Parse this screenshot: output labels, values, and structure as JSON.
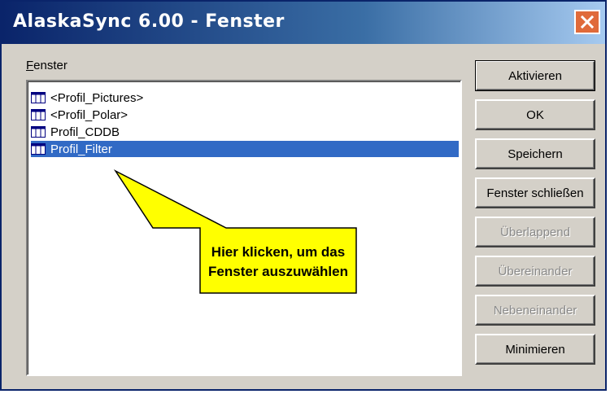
{
  "window": {
    "title": "AlaskaSync 6.00 - Fenster",
    "close_icon": "close-icon"
  },
  "list": {
    "label": "Fenster",
    "items": [
      {
        "label": "<Profil_Pictures>",
        "icon": "grid-window-icon",
        "selected": false
      },
      {
        "label": "<Profil_Polar>",
        "icon": "grid-window-icon",
        "selected": false
      },
      {
        "label": "Profil_CDDB",
        "icon": "grid-window-icon",
        "selected": false
      },
      {
        "label": "Profil_Filter",
        "icon": "grid-window-icon",
        "selected": true
      }
    ]
  },
  "buttons": {
    "activate": "Aktivieren",
    "ok": "OK",
    "save": "Speichern",
    "close_window": "Fenster schließen",
    "cascade": "Überlappend",
    "tile_horizontal": "Übereinander",
    "tile_vertical": "Nebeneinander",
    "minimize": "Minimieren"
  },
  "callout": {
    "line1": "Hier klicken, um das",
    "line2": "Fenster auszuwählen"
  },
  "colors": {
    "titlebar_start": "#0a246a",
    "titlebar_end": "#a6caf0",
    "selection": "#316ac5",
    "callout_fill": "#ffff00",
    "close_button": "#e06a3a"
  }
}
